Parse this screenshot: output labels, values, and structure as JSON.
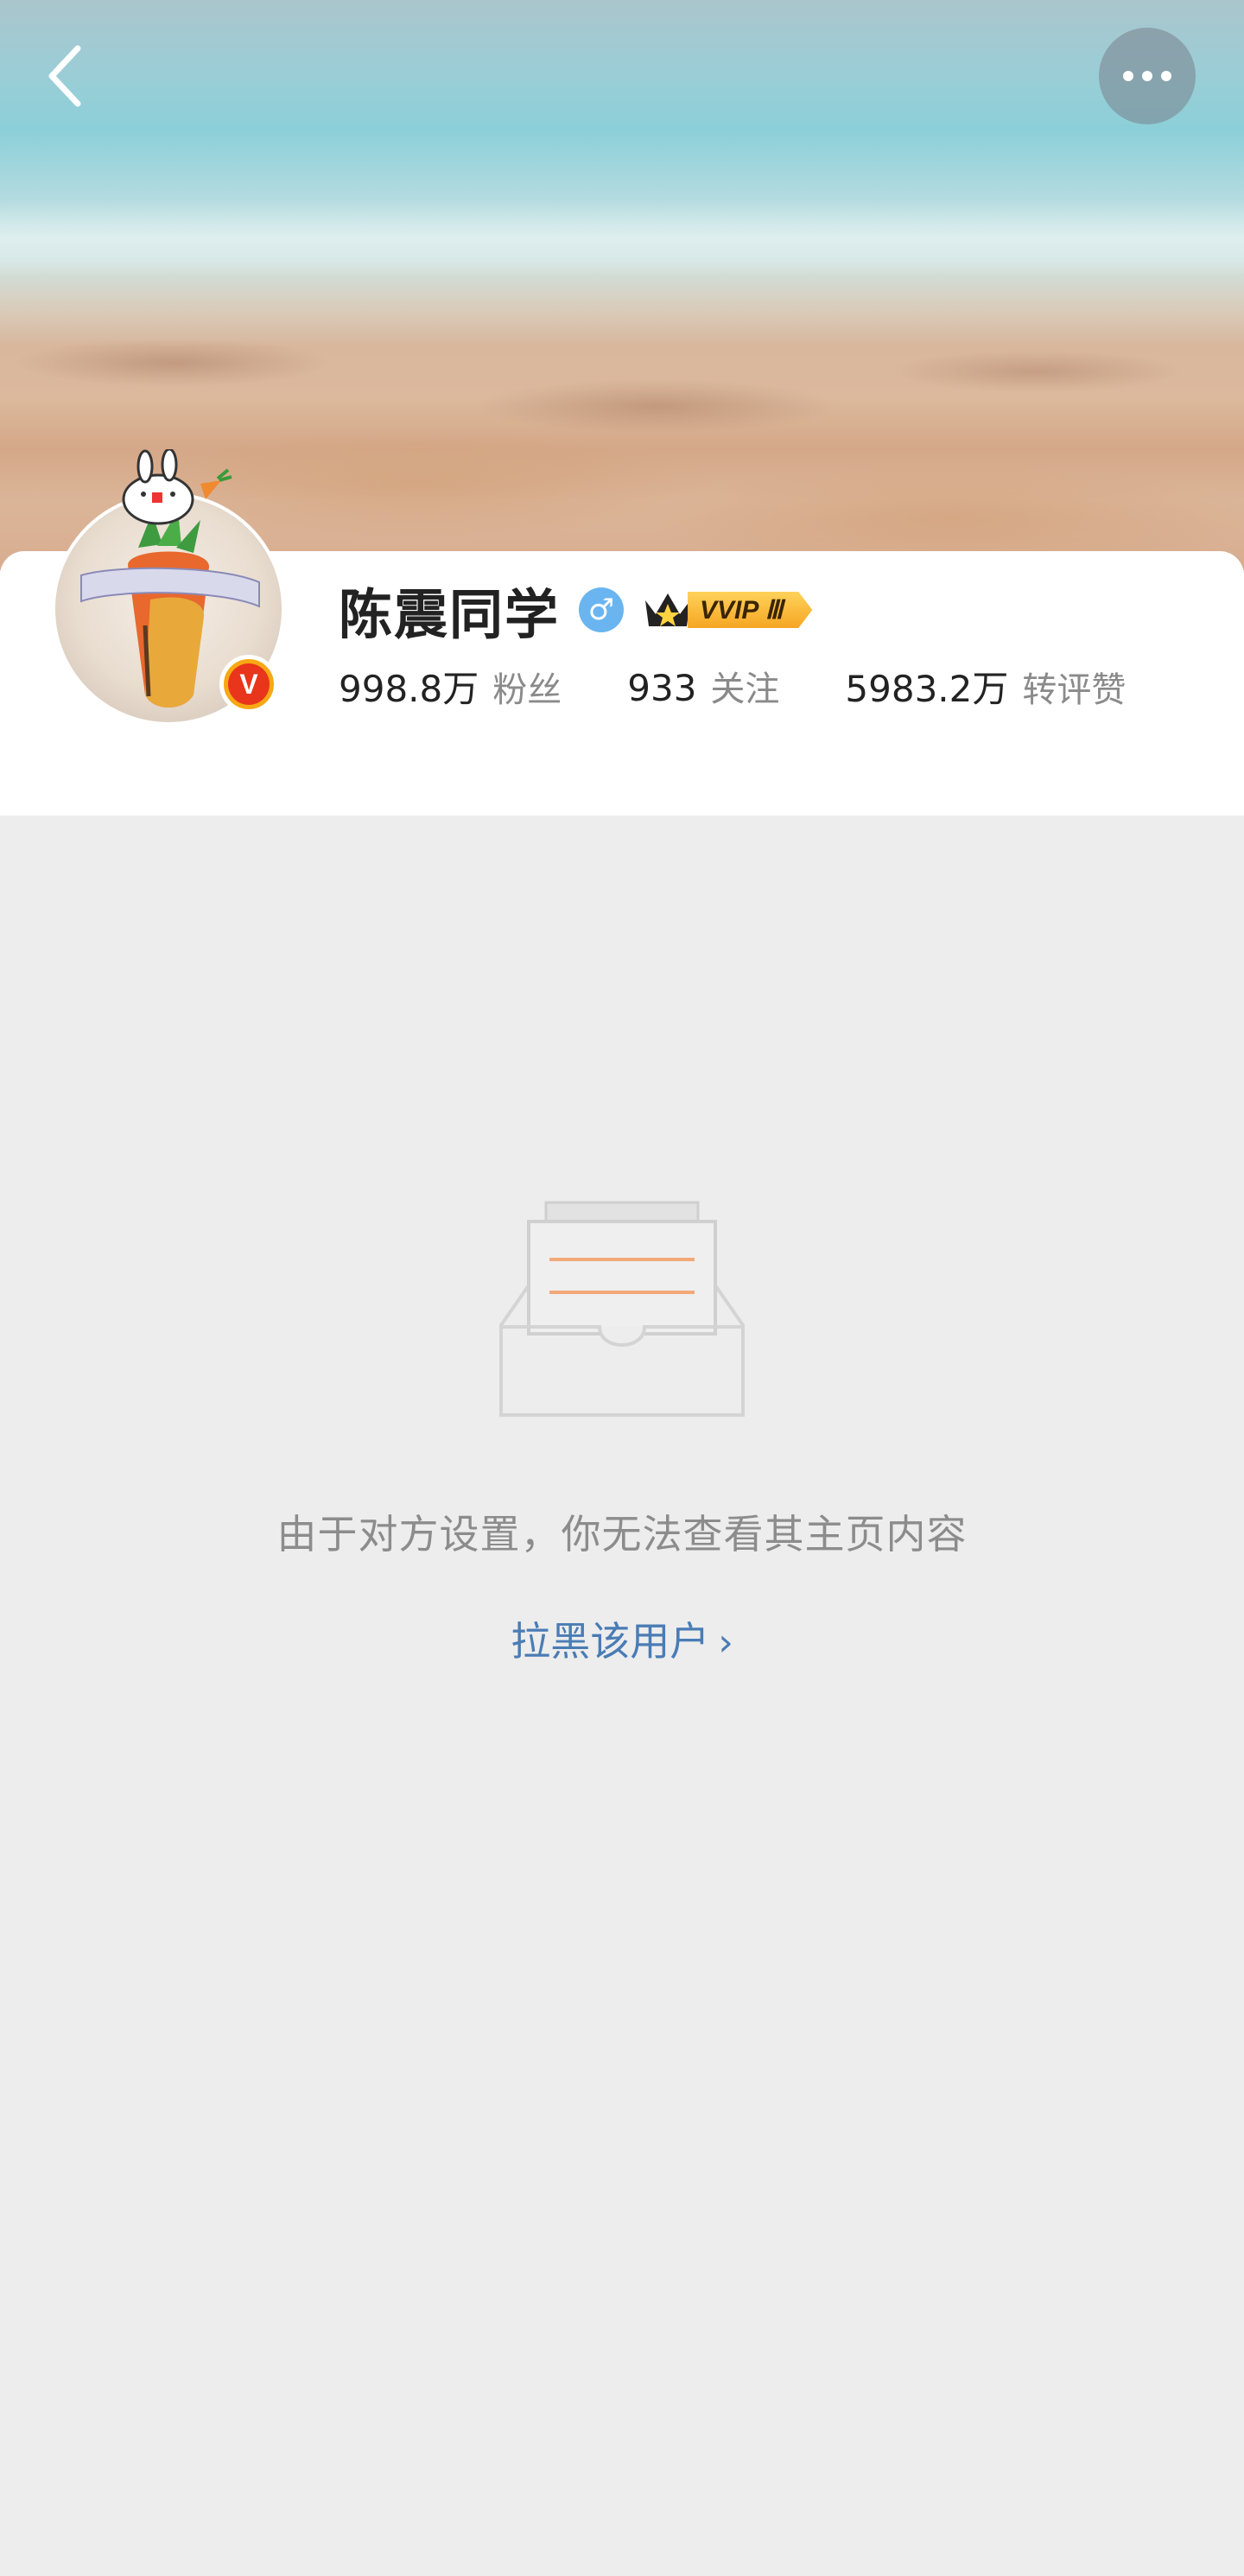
{
  "header": {
    "back_icon": "chevron-left-icon",
    "more_icon": "more-dots-icon"
  },
  "profile": {
    "name": "陈震同学",
    "gender_icon": "male-icon",
    "gender_symbol": "♂",
    "vip_label": "VVIP Ⅲ",
    "verified_badge_letter": "V",
    "stats": [
      {
        "value": "998.8万",
        "label": "粉丝"
      },
      {
        "value": "933",
        "label": "关注"
      },
      {
        "value": "5983.2万",
        "label": "转评赞"
      }
    ]
  },
  "empty_state": {
    "message": "由于对方设置，你无法查看其主页内容",
    "action_label": "拉黑该用户",
    "action_chevron": "›"
  },
  "colors": {
    "background": "#ededed",
    "link": "#4a7cb5",
    "verified_badge": "#f7a814",
    "gender_badge": "#6ab5f0"
  }
}
